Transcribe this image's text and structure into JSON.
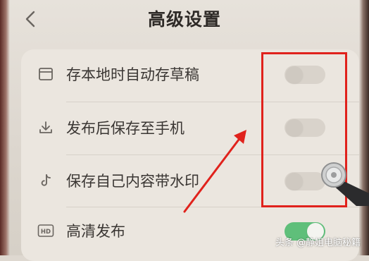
{
  "header": {
    "title": "高级设置",
    "back_icon": "chevron-left-icon"
  },
  "settings": [
    {
      "label": "存本地时自动存草稿",
      "icon": "draft-box-icon",
      "enabled": false
    },
    {
      "label": "发布后保存至手机",
      "icon": "download-icon",
      "enabled": false
    },
    {
      "label": "保存自己内容带水印",
      "icon": "tiktok-note-icon",
      "enabled": false
    },
    {
      "label": "高清发布",
      "icon": "hd-icon",
      "enabled": true
    }
  ],
  "watermark": "头条 @静姐电脑秘籍",
  "colors": {
    "highlight_box": "#e0221c",
    "annotation_arrow": "#e0221c",
    "toggle_on": "#5fbf7a"
  }
}
